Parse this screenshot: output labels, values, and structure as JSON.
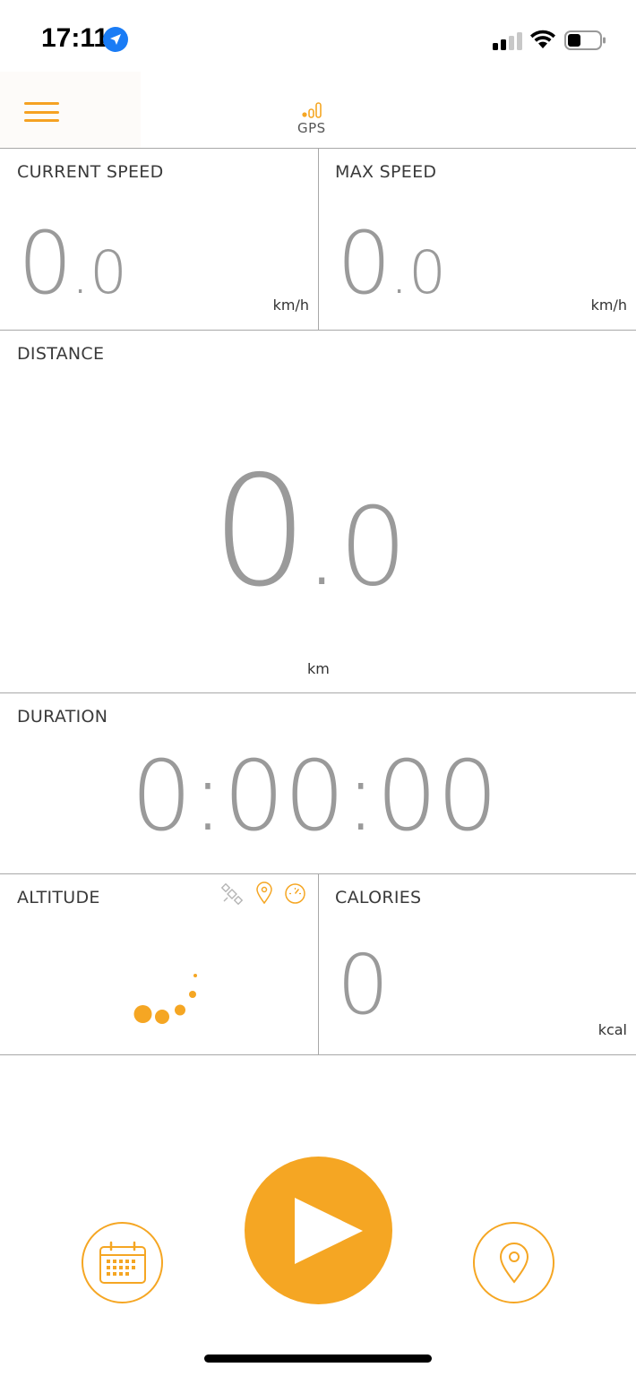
{
  "status_bar": {
    "time": "17:11"
  },
  "header": {
    "gps_label": "GPS"
  },
  "tiles": {
    "current_speed": {
      "label": "CURRENT SPEED",
      "int": "0",
      "dec": ".0",
      "unit": "km/h"
    },
    "max_speed": {
      "label": "MAX SPEED",
      "int": "0",
      "dec": ".0",
      "unit": "km/h"
    },
    "distance": {
      "label": "DISTANCE",
      "int": "0",
      "dec": ".0",
      "unit": "km"
    },
    "duration": {
      "label": "DURATION",
      "value": "0:00:00"
    },
    "altitude": {
      "label": "ALTITUDE"
    },
    "calories": {
      "label": "CALORIES",
      "value": "0",
      "unit": "kcal"
    }
  },
  "icons": {
    "satellite": "satellite-icon",
    "location": "location-pin-icon",
    "speedometer": "speedometer-icon",
    "calendar": "calendar-icon",
    "map_pin": "map-pin-icon",
    "play": "play-icon"
  },
  "colors": {
    "accent": "#f5a623",
    "value_gray": "#9a9a9a",
    "divider": "#a8a8a8",
    "ios_blue": "#1a7cf5"
  }
}
